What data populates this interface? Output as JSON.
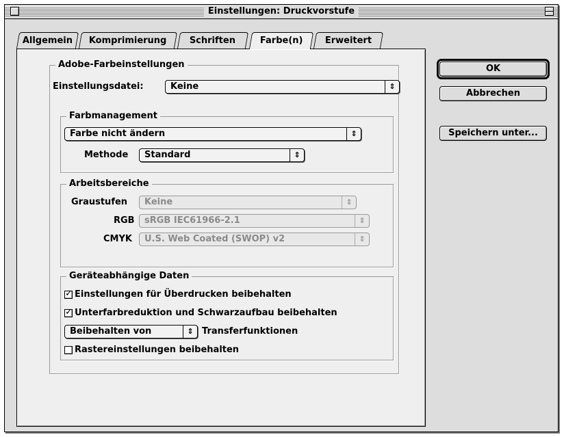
{
  "window": {
    "title": "Einstellungen: Druckvorstufe"
  },
  "tabs": [
    {
      "label": "Allgemein",
      "active": false
    },
    {
      "label": "Komprimierung",
      "active": false
    },
    {
      "label": "Schriften",
      "active": false
    },
    {
      "label": "Farbe(n)",
      "active": true
    },
    {
      "label": "Erweitert",
      "active": false
    }
  ],
  "adobe_settings": {
    "group_title": "Adobe-Farbeinstellungen",
    "settings_file_label": "Einstellungsdatei:",
    "settings_file_value": "Keine"
  },
  "color_management": {
    "group_title": "Farbmanagement",
    "policy_value": "Farbe nicht ändern",
    "method_label": "Methode",
    "method_value": "Standard"
  },
  "working_spaces": {
    "group_title": "Arbeitsbereiche",
    "gray_label": "Graustufen",
    "gray_value": "Keine",
    "rgb_label": "RGB",
    "rgb_value": "sRGB IEC61966-2.1",
    "cmyk_label": "CMYK",
    "cmyk_value": "U.S. Web Coated (SWOP) v2",
    "enabled": false
  },
  "device_dependent": {
    "group_title": "Geräteabhängige Daten",
    "overprint_label": "Einstellungen für Überdrucken beibehalten",
    "overprint_checked": true,
    "ucr_label": "Unterfarbreduktion und Schwarzaufbau beibehalten",
    "ucr_checked": true,
    "transfer_popup_value": "Beibehalten von",
    "transfer_label": "Transferfunktionen",
    "halftone_label": "Rastereinstellungen beibehalten",
    "halftone_checked": false
  },
  "buttons": {
    "ok": "OK",
    "cancel": "Abbrechen",
    "save_as": "Speichern unter..."
  },
  "icons": {
    "popup_arrows": "⇕",
    "checkmark": "✓"
  }
}
